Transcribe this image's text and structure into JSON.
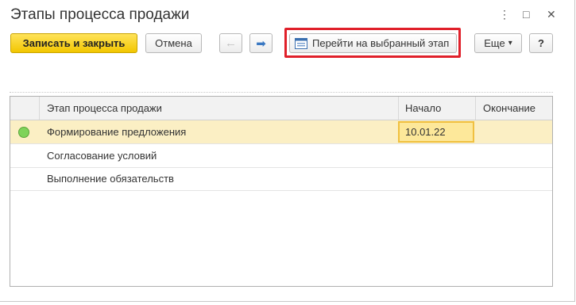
{
  "window": {
    "title": "Этапы процесса продажи",
    "controls": {
      "more": "⋮",
      "maximize": "□",
      "close": "✕"
    }
  },
  "toolbar": {
    "save_close": "Записать и закрыть",
    "cancel": "Отмена",
    "back_icon": "←",
    "forward_icon": "➡",
    "goto_stage": "Перейти на выбранный этап",
    "more": "Еще",
    "more_arrow": "▾",
    "help": "?"
  },
  "table": {
    "columns": [
      "Этап процесса продажи",
      "Начало",
      "Окончание"
    ],
    "rows": [
      {
        "stage": "Формирование предложения",
        "start": "10.01.22",
        "end": "",
        "active": true
      },
      {
        "stage": "Согласование условий",
        "start": "",
        "end": ""
      },
      {
        "stage": "Выполнение обязательств",
        "start": "",
        "end": ""
      }
    ]
  },
  "colors": {
    "primary": "#f2c600",
    "highlight": "#e0202a",
    "active_dot": "#7fd35a"
  }
}
